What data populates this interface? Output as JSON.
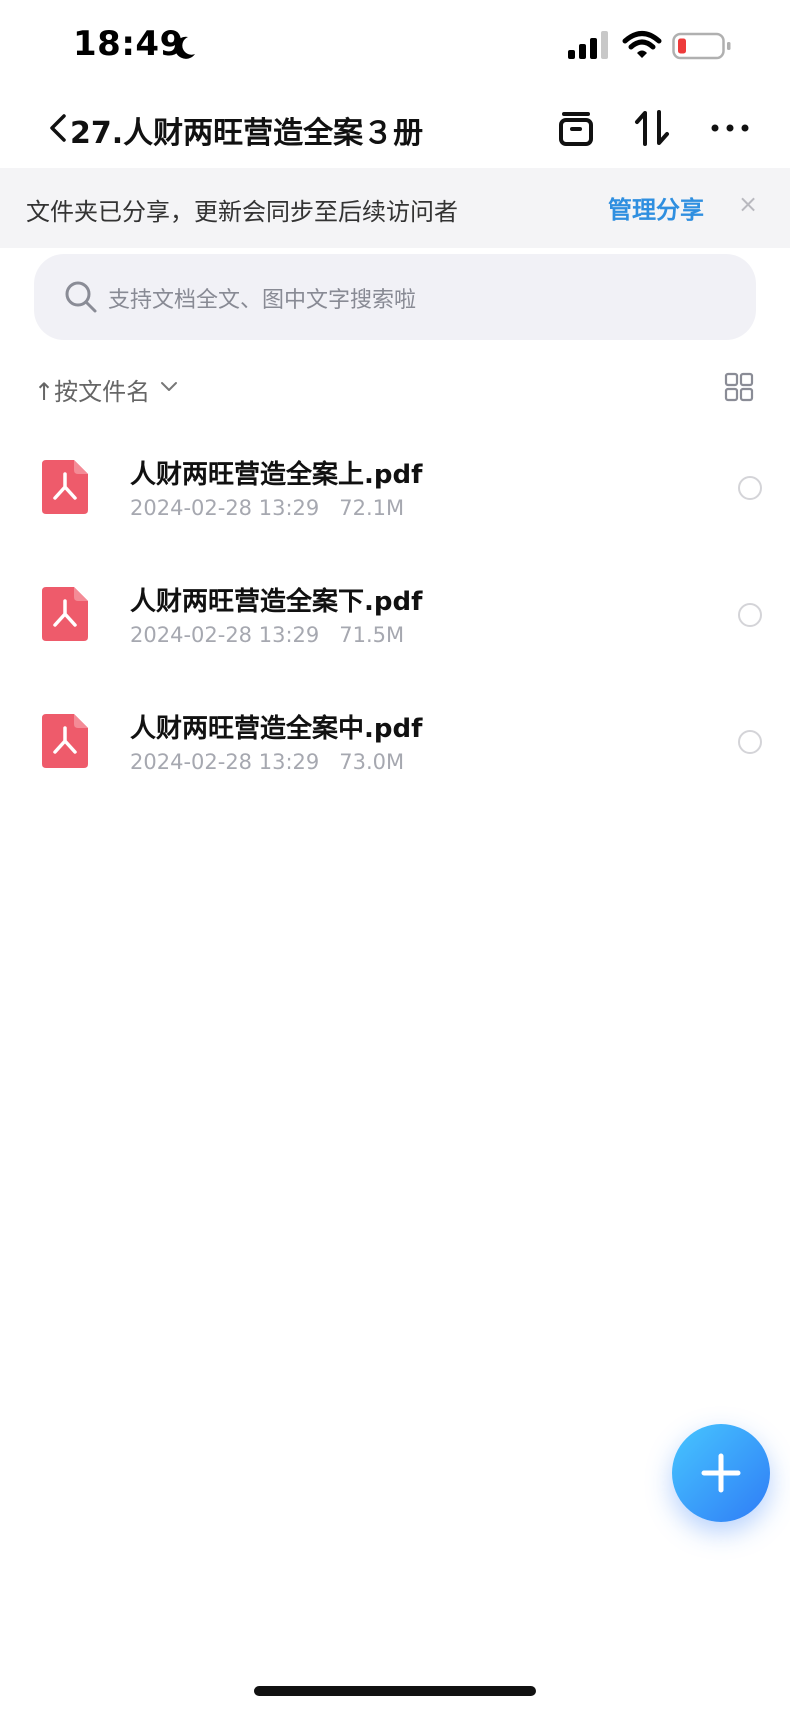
{
  "status": {
    "time": "18:49"
  },
  "nav": {
    "title": "27.人财两旺营造全案３册"
  },
  "share_banner": {
    "text": "文件夹已分享，更新会同步至后续访问者",
    "manage_label": "管理分享",
    "close_glyph": "×"
  },
  "search": {
    "placeholder": "支持文档全文、图中文字搜索啦"
  },
  "sort": {
    "label": "↑按文件名"
  },
  "files": [
    {
      "name": "人财两旺营造全案上.pdf",
      "date": "2024-02-28 13:29",
      "size": "72.1M"
    },
    {
      "name": "人财两旺营造全案下.pdf",
      "date": "2024-02-28 13:29",
      "size": "71.5M"
    },
    {
      "name": "人财两旺营造全案中.pdf",
      "date": "2024-02-28 13:29",
      "size": "73.0M"
    }
  ],
  "colors": {
    "accent": "#2f8fe0",
    "pdf_red": "#ee5b6b",
    "fab": "#3a9cf8"
  },
  "icons": [
    "moon-icon",
    "signal-icon",
    "wifi-icon",
    "battery-icon",
    "back-icon",
    "clear-icon",
    "sort-swap-icon",
    "more-icon",
    "search-icon",
    "chevron-down-icon",
    "grid-view-icon",
    "pdf-icon",
    "plus-icon"
  ]
}
